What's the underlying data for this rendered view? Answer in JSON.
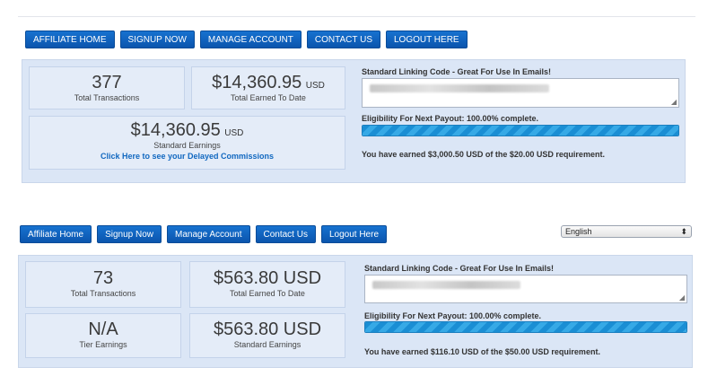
{
  "section1": {
    "nav": [
      "AFFILIATE HOME",
      "SIGNUP NOW",
      "MANAGE ACCOUNT",
      "CONTACT US",
      "LOGOUT HERE"
    ],
    "transactions": {
      "value": "377",
      "label": "Total Transactions"
    },
    "earned": {
      "value": "$14,360.95",
      "unit": "USD",
      "label": "Total Earned To Date"
    },
    "standard": {
      "value": "$14,360.95",
      "unit": "USD",
      "label": "Standard Earnings",
      "link": "Click Here to see your Delayed Commissions"
    },
    "linking_label": "Standard Linking Code - Great For Use In Emails!",
    "eligibility": "Eligibility For Next Payout: 100.00% complete.",
    "progress": 1.0,
    "earned_message": "You have earned $3,000.50 USD of the $20.00 USD requirement."
  },
  "section2": {
    "nav": [
      "Affiliate Home",
      "Signup Now",
      "Manage Account",
      "Contact Us",
      "Logout Here"
    ],
    "language": "English",
    "transactions": {
      "value": "73",
      "label": "Total Transactions"
    },
    "earned": {
      "value": "$563.80 USD",
      "label": "Total Earned To Date"
    },
    "tier": {
      "value": "N/A",
      "label": "Tier Earnings"
    },
    "standard": {
      "value": "$563.80 USD",
      "label": "Standard Earnings"
    },
    "linking_label": "Standard Linking Code - Great For Use In Emails!",
    "eligibility": "Eligibility For Next Payout: 100.00% complete.",
    "progress": 1.0,
    "earned_message": "You have earned $116.10 USD of the $50.00 USD requirement."
  },
  "colors": {
    "button": "#0f63bf",
    "panel": "#dbe6f6",
    "progress": "#1a8ed4",
    "link": "#1168c0"
  }
}
